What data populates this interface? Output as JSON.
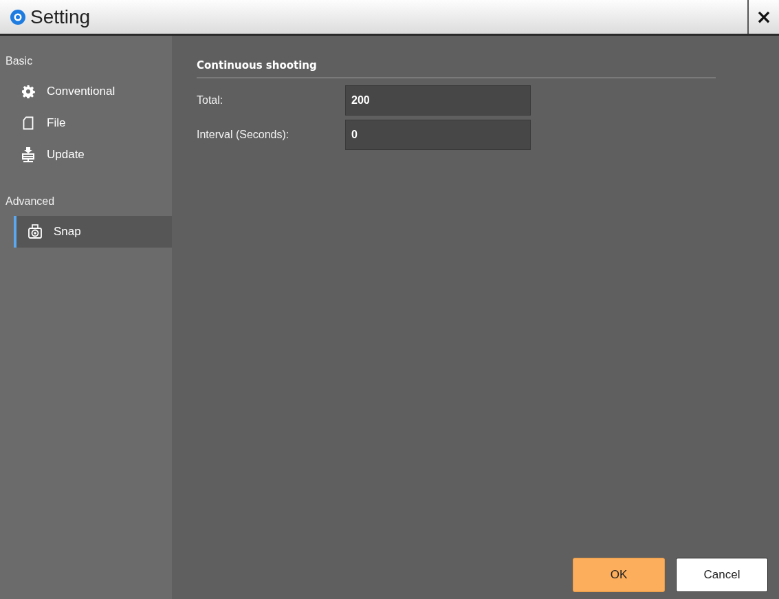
{
  "window": {
    "title": "Setting",
    "close": "×"
  },
  "sidebar": {
    "groups": [
      {
        "label": "Basic",
        "items": [
          {
            "label": "Conventional",
            "kind": "gear",
            "selected": false
          },
          {
            "label": "File",
            "kind": "file",
            "selected": false
          },
          {
            "label": "Update",
            "kind": "update",
            "selected": false
          }
        ]
      },
      {
        "label": "Advanced",
        "items": [
          {
            "label": "Snap",
            "kind": "camera",
            "selected": true
          }
        ]
      }
    ]
  },
  "section": {
    "title": "Continuous shooting",
    "fields": [
      {
        "label": "Total:",
        "value": "200"
      },
      {
        "label": "Interval (Seconds):",
        "value": "0"
      }
    ]
  },
  "buttons": [
    {
      "label": "OK",
      "kind": "primary"
    },
    {
      "label": "Cancel",
      "kind": "secondary"
    }
  ]
}
